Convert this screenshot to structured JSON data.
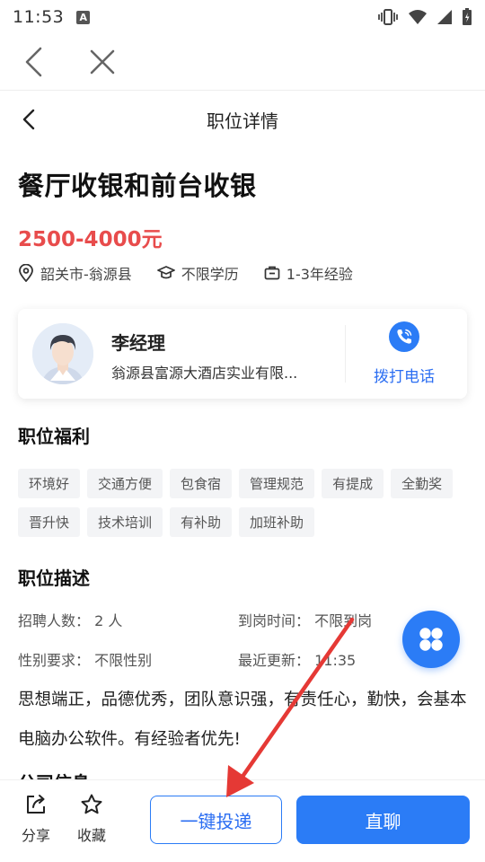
{
  "status_bar": {
    "time": "11:53",
    "notif_letter": "A"
  },
  "nav": {
    "title": "职位详情"
  },
  "job": {
    "title": "餐厅收银和前台收银",
    "salary": "2500-4000元",
    "location": "韶关市-翁源县",
    "education": "不限学历",
    "experience": "1-3年经验"
  },
  "recruiter": {
    "name": "李经理",
    "company": "翁源县富源大酒店实业有限...",
    "call_label": "拨打电话"
  },
  "benefits": {
    "title": "职位福利",
    "tags": [
      "环境好",
      "交通方便",
      "包食宿",
      "管理规范",
      "有提成",
      "全勤奖",
      "晋升快",
      "技术培训",
      "有补助",
      "加班补助"
    ]
  },
  "description": {
    "title": "职位描述",
    "headcount": "招聘人数： 2 人",
    "start_time": "到岗时间： 不限到岗",
    "gender": "性别要求： 不限性别",
    "updated": "最近更新： 11:35",
    "text": "思想端正，品德优秀，团队意识强，有责任心，勤快，会基本电脑办公软件。有经验者优先!"
  },
  "company_section_title": "公司信息",
  "bottom": {
    "share_label": "分享",
    "favorite_label": "收藏",
    "apply_label": "一键投递",
    "chat_label": "直聊"
  },
  "colors": {
    "accent": "#2b7cf6",
    "salary": "#e84c4c",
    "annotation_arrow": "#e53935"
  }
}
